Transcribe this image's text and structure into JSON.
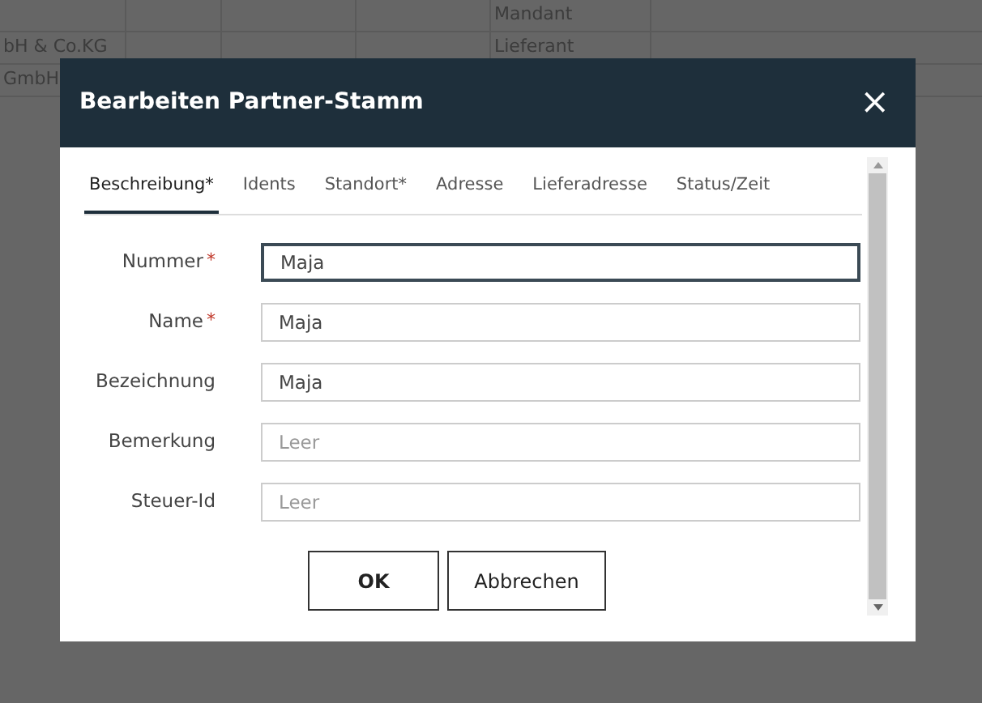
{
  "background_table": {
    "rows": [
      [
        "",
        "",
        "",
        "",
        "Mandant"
      ],
      [
        "bH & Co.KG",
        "",
        "",
        "",
        "Lieferant"
      ],
      [
        "GmbH",
        "",
        "",
        "",
        ""
      ]
    ]
  },
  "dialog": {
    "title": "Bearbeiten Partner-Stamm",
    "close": "×",
    "tabs": [
      {
        "label": "Beschreibung*",
        "selected": true
      },
      {
        "label": "Idents",
        "selected": false
      },
      {
        "label": "Standort*",
        "selected": false
      },
      {
        "label": "Adresse",
        "selected": false
      },
      {
        "label": "Lieferadresse",
        "selected": false
      },
      {
        "label": "Status/Zeit",
        "selected": false
      }
    ],
    "fields": [
      {
        "label": "Nummer",
        "required_mark": "*",
        "value": "Maja",
        "focused": true
      },
      {
        "label": "Name",
        "required_mark": "*",
        "value": "Maja",
        "focused": false
      },
      {
        "label": "Bezeichnung",
        "value": "Maja",
        "focused": false
      },
      {
        "label": "Bemerkung",
        "placeholder": "Leer",
        "focused": false
      },
      {
        "label": "Steuer-Id",
        "placeholder": "Leer",
        "focused": false
      }
    ],
    "buttons": [
      {
        "label": "OK",
        "primary": true
      },
      {
        "label": "Abbrechen",
        "primary": false
      }
    ]
  }
}
